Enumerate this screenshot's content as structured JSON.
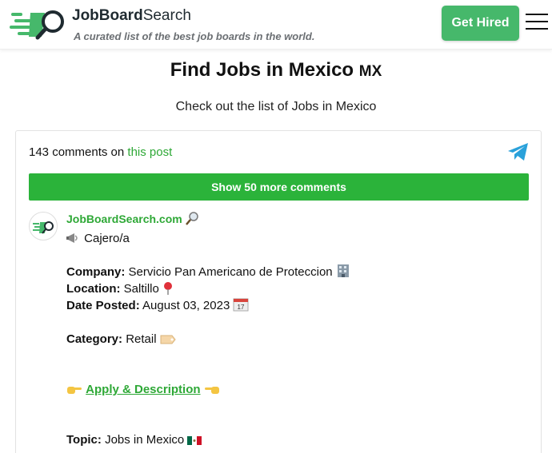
{
  "header": {
    "brand_bold": "JobBoard",
    "brand_light": "Search",
    "tagline": "A curated list of the best job boards in the world.",
    "cta_label": "Get Hired"
  },
  "page": {
    "title": "Find Jobs in Mexico",
    "country_code": "MX",
    "subtitle": "Check out the list of Jobs in Mexico"
  },
  "comments": {
    "count_text": "143 comments on ",
    "post_link": "this post",
    "show_more_label": "Show 50 more comments"
  },
  "post": {
    "author": "JobBoardSearch.com",
    "job_title": "Cajero/a",
    "company_label": "Company:",
    "company_value": "Servicio Pan Americano de Proteccion",
    "location_label": "Location:",
    "location_value": "Saltillo",
    "date_label": "Date Posted:",
    "date_value": "August 03, 2023",
    "category_label": "Category:",
    "category_value": "Retail",
    "apply_label": "Apply & Description",
    "topic_label": "Topic:",
    "topic_value": "Jobs in Mexico"
  },
  "colors": {
    "brand_green": "#46b86b",
    "link_green": "#2ea836",
    "button_green": "#2bb33a",
    "telegram_blue": "#2aa1da"
  }
}
